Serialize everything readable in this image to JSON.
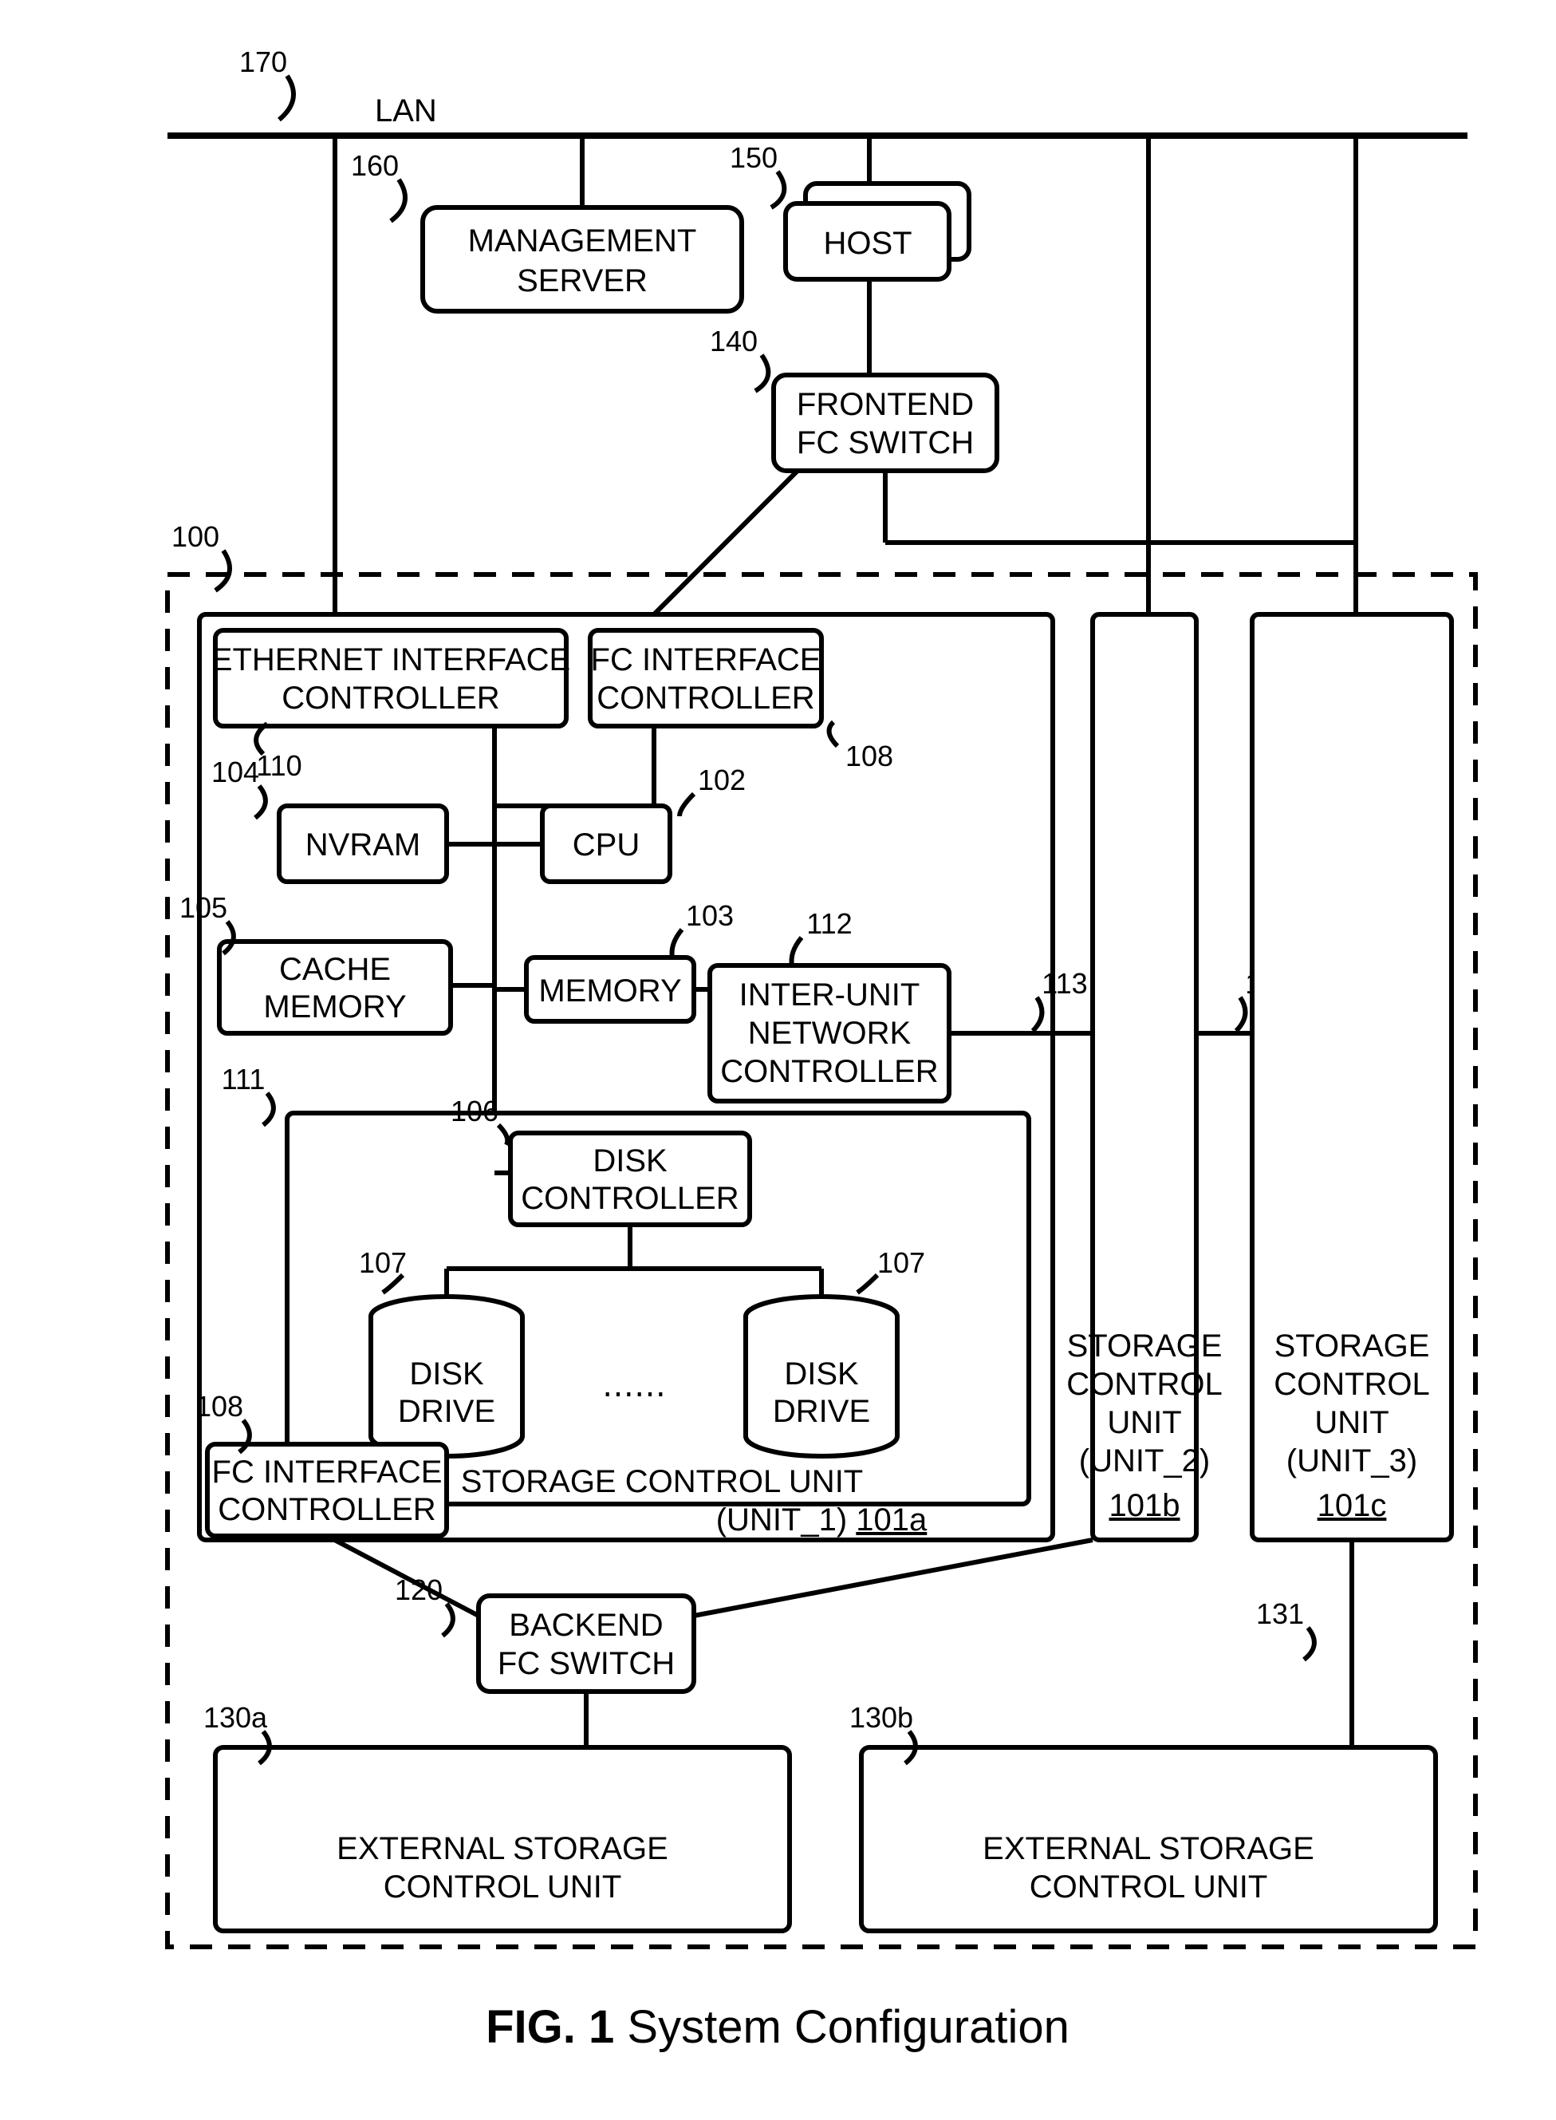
{
  "figure": {
    "num": "FIG. 1",
    "title": "System Configuration"
  },
  "labels": {
    "lan": "LAN",
    "mgmt": "MANAGEMENT\nSERVER",
    "host": "HOST",
    "fefc": "FRONTEND\nFC SWITCH",
    "eth": "ETHERNET INTERFACE\nCONTROLLER",
    "fcif": "FC INTERFACE\nCONTROLLER",
    "nvram": "NVRAM",
    "cpu": "CPU",
    "cache": "CACHE\nMEMORY",
    "memory": "MEMORY",
    "iun": "INTER-UNIT\nNETWORK\nCONTROLLER",
    "diskctrl": "DISK\nCONTROLLER",
    "disk": "DISK\nDRIVE",
    "fcif2": "FC INTERFACE\nCONTROLLER",
    "scu1a": "STORAGE CONTROL UNIT",
    "scu1b": "(UNIT_1)",
    "scu1c": "101a",
    "scu2a": "STORAGE",
    "scu2b": "CONTROL",
    "scu2c": "UNIT",
    "scu2d": "(UNIT_2)",
    "scu2e": "101b",
    "scu3a": "STORAGE",
    "scu3b": "CONTROL",
    "scu3c": "UNIT",
    "scu3d": "(UNIT_3)",
    "scu3e": "101c",
    "befc": "BACKEND\nFC SWITCH",
    "ext": "EXTERNAL STORAGE\nCONTROL UNIT"
  },
  "refs": {
    "r170": "170",
    "r160": "160",
    "r150": "150",
    "r140": "140",
    "r100": "100",
    "r110": "110",
    "r108": "108",
    "r104": "104",
    "r102": "102",
    "r105": "105",
    "r103": "103",
    "r112": "112",
    "r113": "113",
    "r111": "111",
    "r106": "106",
    "r107": "107",
    "r108b": "108",
    "r120": "120",
    "r130a": "130a",
    "r130b": "130b",
    "r131": "131"
  }
}
